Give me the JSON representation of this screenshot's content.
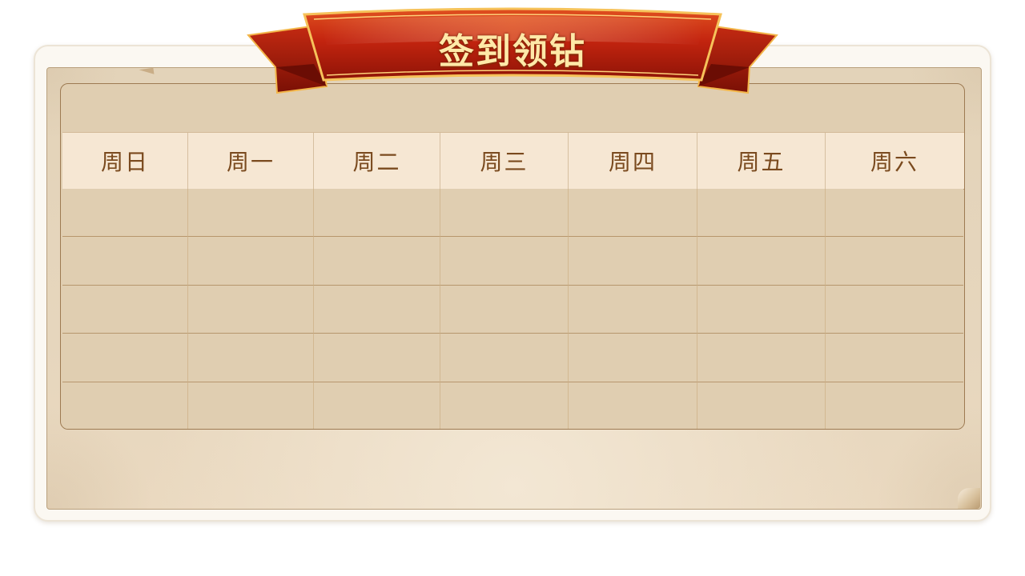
{
  "title": "签到领钻",
  "weekdays": [
    "周日",
    "周一",
    "周二",
    "周三",
    "周四",
    "周五",
    "周六"
  ],
  "grid": {
    "rows": 5,
    "columns": 7
  },
  "colors": {
    "ribbon_red": "#b8200f",
    "ribbon_gold": "#f3b64a",
    "title_text": "#ffe9a8",
    "weekday_text": "#7a4a1e",
    "board_fill": "#e0ceb1",
    "header_fill": "#f6e7d3"
  }
}
